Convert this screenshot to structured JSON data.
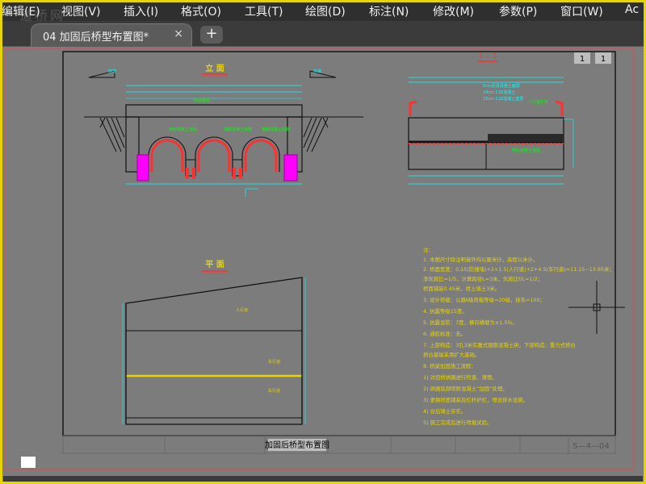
{
  "menu": {
    "items": [
      {
        "label": "编辑(E)"
      },
      {
        "label": "视图(V)"
      },
      {
        "label": "插入(I)"
      },
      {
        "label": "格式(O)"
      },
      {
        "label": "工具(T)"
      },
      {
        "label": "绘图(D)"
      },
      {
        "label": "标注(N)"
      },
      {
        "label": "修改(M)"
      },
      {
        "label": "参数(P)"
      },
      {
        "label": "窗口(W)"
      },
      {
        "label": "Ac"
      }
    ],
    "watermark": "道桥网"
  },
  "tabs": {
    "active_label": "04 加固后桥型布置图*",
    "close_symbol": "×",
    "add_symbol": "+"
  },
  "drawing": {
    "elevation_title": "立  面",
    "section_title": "1 — 1",
    "plan_title": "平  面",
    "section_marker_left": "1",
    "section_marker_right": "1",
    "left_mark": "西端",
    "right_mark": "东端",
    "sheet_title": "加固后桥型布置图",
    "sheet_number": "S—4—04",
    "notes": [
      "注：",
      "1. 本图尺寸除注明者外均以厘米计，高程以米计。",
      "2. 桥面宽度：0.15(防撞墙)+2×1.5(人行道)+2+4.5(车行道)=11.15~13.65米；",
      "   净矢跨比=1/5，计算跨径L=3米，矢跨比f/L=1/2；",
      "   桥面铺装0.45米，桥上填土3米。",
      "3. 设计荷载：公路Ⅱ级荷载等级=20级，挂车=100；",
      "4. 抗震等级15度。",
      "5. 抗震设防：7度，横向横坡为±1.5%。",
      "6. 通航标准：无。",
      "7. 上部构造：3孔3米实腹式钢筋混凝土拱，下部构造：重力式桥台",
      "   桥台基础采用扩大基础。",
      "8. 桥梁加固施工流程：",
      "   1) 对旧桥拱圈进行检查、清理。",
      "   2) 拱圈底部喷射混凝土“加固”处理。",
      "   3) 更换桥面铺装及栏杆护栏，增设排水设施。",
      "   4) 台后填土夯实。",
      "   5) 施工完成后进行荷载试验。"
    ],
    "plan_labels": [
      "人行道",
      "车行道",
      "车行道"
    ],
    "elevation_labels": [
      "桥面铺装",
      "喷射混凝土加固",
      "钢筋混凝土拱圈",
      "钢筋混凝土拱圈"
    ],
    "section_labels": [
      "5cm沥青混凝土面层",
      "24cm C30混凝土",
      "15cm C20混凝土垫层",
      "人行道栏杆"
    ]
  },
  "colors": {
    "accent_yellow": "#e8d400",
    "line_cyan": "#00ffff",
    "line_red": "#ff3030",
    "magenta": "#ff00ff",
    "dim_green": "#00ff00"
  }
}
